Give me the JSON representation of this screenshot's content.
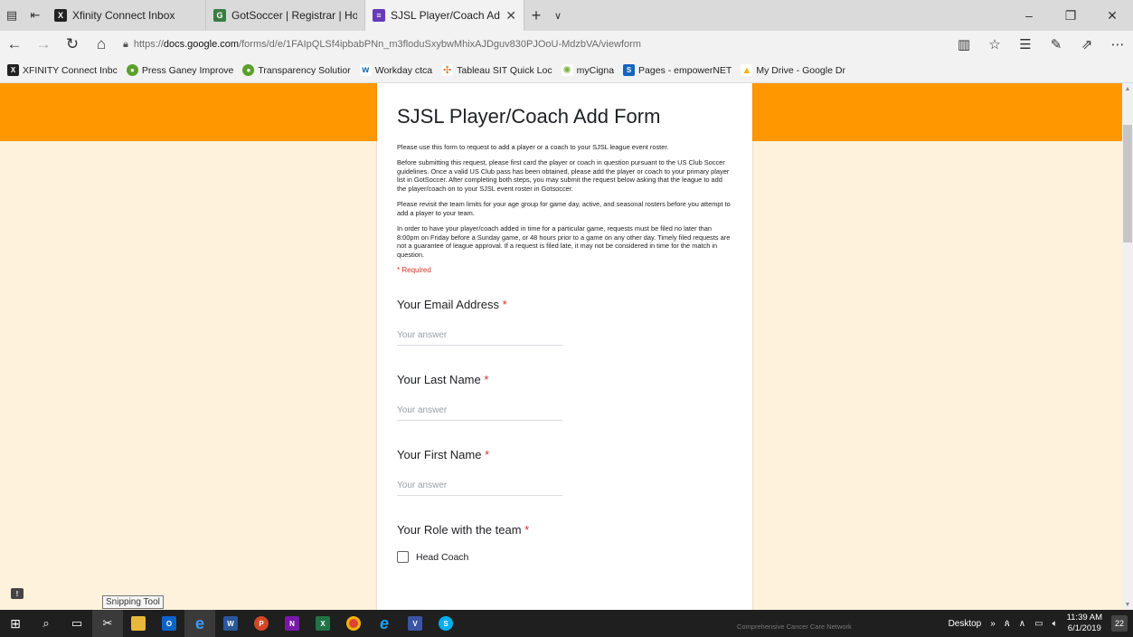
{
  "browser": {
    "tabs": [
      {
        "title": "Xfinity Connect Inbox",
        "icon": "xfinity-icon",
        "color": "#222222",
        "active": false
      },
      {
        "title": "GotSoccer | Registrar | Hom",
        "icon": "gotsoccer-icon",
        "color": "#3a7d44",
        "active": false
      },
      {
        "title": "SJSL Player/Coach Add",
        "icon": "google-forms-icon",
        "color": "#673ab7",
        "active": true
      }
    ],
    "url_prefix": "https://",
    "url_host": "docs.google.com",
    "url_path": "/forms/d/e/1FAIpQLSf4ipbabPNn_m3floduSxybwMhixAJDguv830PJOoU-MdzbVA/viewform",
    "favorites": [
      {
        "label": "XFINITY Connect Inbc",
        "color": "#222222"
      },
      {
        "label": "Press Ganey Improve",
        "color": "#5aa02c"
      },
      {
        "label": "Transparency Solutior",
        "color": "#5aa02c"
      },
      {
        "label": "Workday ctca",
        "color": "#0066b3"
      },
      {
        "label": "Tableau SIT Quick Loc",
        "color": "#e8762c"
      },
      {
        "label": "myCigna",
        "color": "#7cb342"
      },
      {
        "label": "Pages - empowerNET",
        "color": "#1565c0"
      },
      {
        "label": "My Drive - Google Dr",
        "color": "#f4b400"
      }
    ]
  },
  "form": {
    "title": "SJSL Player/Coach Add Form",
    "description": [
      "Please use this form to request to add a player or a coach to your SJSL league event roster.",
      "Before submitting this request, please first card the player or coach in question pursuant to the US Club Soccer guidelines. Once a valid US Club pass has been obtained, please add the player or coach to your primary player list in GotSoccer.  After completing both steps, you may submit the request below asking that the league to add the player/coach on to your SJSL event roster in Gotsoccer.",
      "Please revisit the team limits for your age group for game day, active, and seasonal rosters before you attempt to add a player to your team.",
      "In order to have your player/coach added in time for a particular game, requests must be filed no later than 8:00pm on Friday before a Sunday game, or 48 hours prior to a game on any other day.  Timely filed requests are not a guarantee of league approval.  If a request is filed late, it may not be considered in time for the match in question."
    ],
    "required_note": "* Required",
    "questions": {
      "email": {
        "label": "Your Email Address",
        "star": "*",
        "placeholder": "Your answer"
      },
      "last_name": {
        "label": "Your Last Name",
        "star": "*",
        "placeholder": "Your answer"
      },
      "first_name": {
        "label": "Your First Name",
        "star": "*",
        "placeholder": "Your answer"
      },
      "role": {
        "label": "Your Role with the team",
        "star": "*",
        "options": [
          "Head Coach"
        ]
      }
    }
  },
  "tooltip": "Snipping Tool",
  "taskbar": {
    "network_label": "Comprehensive Cancer Care Network",
    "desktop_label": "Desktop",
    "time": "11:39 AM",
    "date": "6/1/2019",
    "notifications": "22"
  },
  "colors": {
    "header_orange": "#ff9800",
    "page_bg": "#fef2dc",
    "required_red": "#d93025"
  }
}
